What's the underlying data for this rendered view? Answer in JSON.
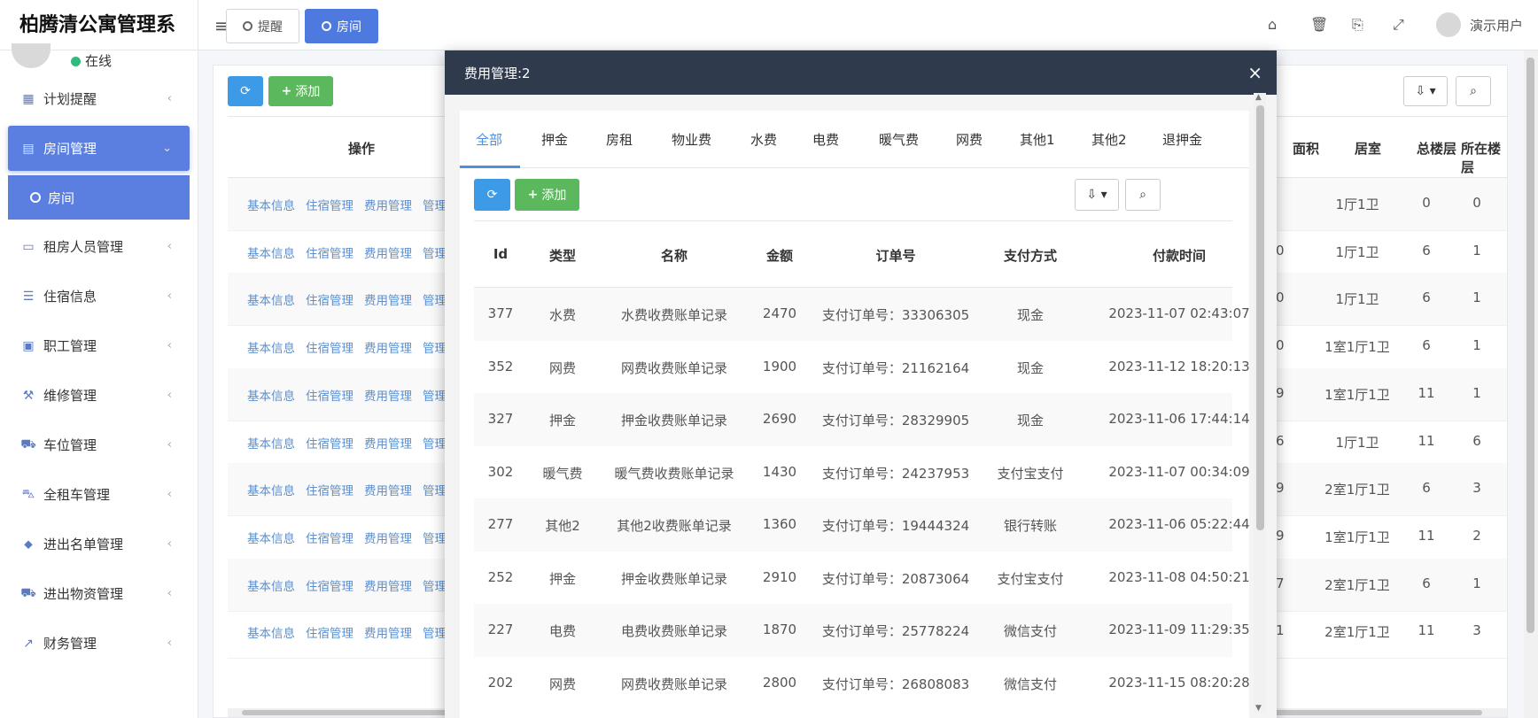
{
  "app": {
    "title": "柏腾清公寓管理系",
    "status": "在线"
  },
  "sidebar": {
    "items": [
      {
        "label": "计划提醒",
        "icon": "calendar-icon",
        "glyph": "▦"
      },
      {
        "label": "房间管理",
        "icon": "building-icon",
        "glyph": "▤",
        "active": true
      },
      {
        "label": "租房人员管理",
        "icon": "id-card-icon",
        "glyph": "▭"
      },
      {
        "label": "住宿信息",
        "icon": "list-icon",
        "glyph": "☰"
      },
      {
        "label": "职工管理",
        "icon": "user-badge-icon",
        "glyph": "▣"
      },
      {
        "label": "维修管理",
        "icon": "wrench-icon",
        "glyph": "⚒"
      },
      {
        "label": "车位管理",
        "icon": "road-icon",
        "glyph": "⛟"
      },
      {
        "label": "全租车管理",
        "icon": "car-icon",
        "glyph": "⛍"
      },
      {
        "label": "进出名单管理",
        "icon": "tag-icon",
        "glyph": "⬥"
      },
      {
        "label": "进出物资管理",
        "icon": "truck-icon",
        "glyph": "⛟"
      },
      {
        "label": "财务管理",
        "icon": "line-chart-icon",
        "glyph": "↗"
      }
    ],
    "submenu": {
      "label": "房间"
    }
  },
  "topbar": {
    "tabs": [
      {
        "label": "提醒"
      },
      {
        "label": "房间"
      }
    ],
    "user": "演示用户",
    "icons": [
      "home-icon",
      "trash-icon",
      "translate-icon",
      "fullscreen-icon"
    ]
  },
  "background_table": {
    "add_label": "添加",
    "columns": {
      "ops": "操作",
      "area": "面积",
      "room": "居室",
      "floors": "总楼层",
      "floor": "所在楼层"
    },
    "links": [
      "基本信息",
      "住宿管理",
      "费用管理",
      "管理"
    ],
    "rows": [
      {
        "area": "",
        "room": "1厅1卫",
        "floors": "0",
        "floor": "0"
      },
      {
        "area": "0",
        "room": "1厅1卫",
        "floors": "6",
        "floor": "1"
      },
      {
        "area": "0",
        "room": "1厅1卫",
        "floors": "6",
        "floor": "1"
      },
      {
        "area": "0",
        "room": "1室1厅1卫",
        "floors": "6",
        "floor": "1"
      },
      {
        "area": "9",
        "room": "1室1厅1卫",
        "floors": "11",
        "floor": "1"
      },
      {
        "area": "6",
        "room": "1厅1卫",
        "floors": "11",
        "floor": "6"
      },
      {
        "area": "9",
        "room": "2室1厅1卫",
        "floors": "6",
        "floor": "3"
      },
      {
        "area": "9",
        "room": "1室1厅1卫",
        "floors": "11",
        "floor": "2"
      },
      {
        "area": "7",
        "room": "2室1厅1卫",
        "floors": "6",
        "floor": "1"
      },
      {
        "area": "1",
        "room": "2室1厅1卫",
        "floors": "11",
        "floor": "3"
      }
    ]
  },
  "modal": {
    "title": "费用管理:2",
    "close": "×",
    "tabs": [
      "全部",
      "押金",
      "房租",
      "物业费",
      "水费",
      "电费",
      "暖气费",
      "网费",
      "其他1",
      "其他2",
      "退押金"
    ],
    "add_label": "添加",
    "columns": [
      "Id",
      "类型",
      "名称",
      "金额",
      "订单号",
      "支付方式",
      "付款时间"
    ],
    "rows": [
      [
        "377",
        "水费",
        "水费收费账单记录",
        "2470",
        "支付订单号：33306305",
        "现金",
        "2023-11-07 02:43:07"
      ],
      [
        "352",
        "网费",
        "网费收费账单记录",
        "1900",
        "支付订单号：21162164",
        "现金",
        "2023-11-12 18:20:13"
      ],
      [
        "327",
        "押金",
        "押金收费账单记录",
        "2690",
        "支付订单号：28329905",
        "现金",
        "2023-11-06 17:44:14"
      ],
      [
        "302",
        "暖气费",
        "暖气费收费账单记录",
        "1430",
        "支付订单号：24237953",
        "支付宝支付",
        "2023-11-07 00:34:09"
      ],
      [
        "277",
        "其他2",
        "其他2收费账单记录",
        "1360",
        "支付订单号：19444324",
        "银行转账",
        "2023-11-06 05:22:44"
      ],
      [
        "252",
        "押金",
        "押金收费账单记录",
        "2910",
        "支付订单号：20873064",
        "支付宝支付",
        "2023-11-08 04:50:21"
      ],
      [
        "227",
        "电费",
        "电费收费账单记录",
        "1870",
        "支付订单号：25778224",
        "微信支付",
        "2023-11-09 11:29:35"
      ],
      [
        "202",
        "网费",
        "网费收费账单记录",
        "2800",
        "支付订单号：26808083",
        "微信支付",
        "2023-11-15 08:20:28"
      ]
    ]
  },
  "colors": {
    "primary": "#4e7ae0",
    "modal_header": "#2f3b4c",
    "success": "#5cb85c",
    "info": "#3c9ae6",
    "link": "#5b8fd0"
  }
}
